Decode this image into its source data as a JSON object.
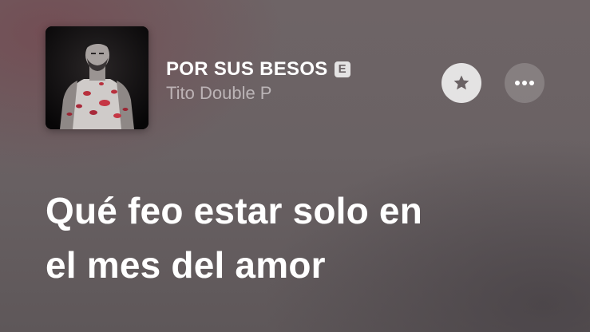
{
  "now_playing": {
    "title": "POR SUS BESOS",
    "explicit_badge": "E",
    "artist": "Tito Double P",
    "artwork_icon": "album-artwork-icon"
  },
  "actions": {
    "favorite_icon": "star-icon",
    "more_icon": "ellipsis-icon"
  },
  "lyrics": {
    "line1": "Qué feo estar solo en",
    "line2": "el mes del amor"
  },
  "colors": {
    "background_top": "#6e6466",
    "background_bottom": "#5e5759",
    "accent_tint": "#7a3c46",
    "text_primary": "#ffffff",
    "text_secondary": "#a7a2a4"
  }
}
